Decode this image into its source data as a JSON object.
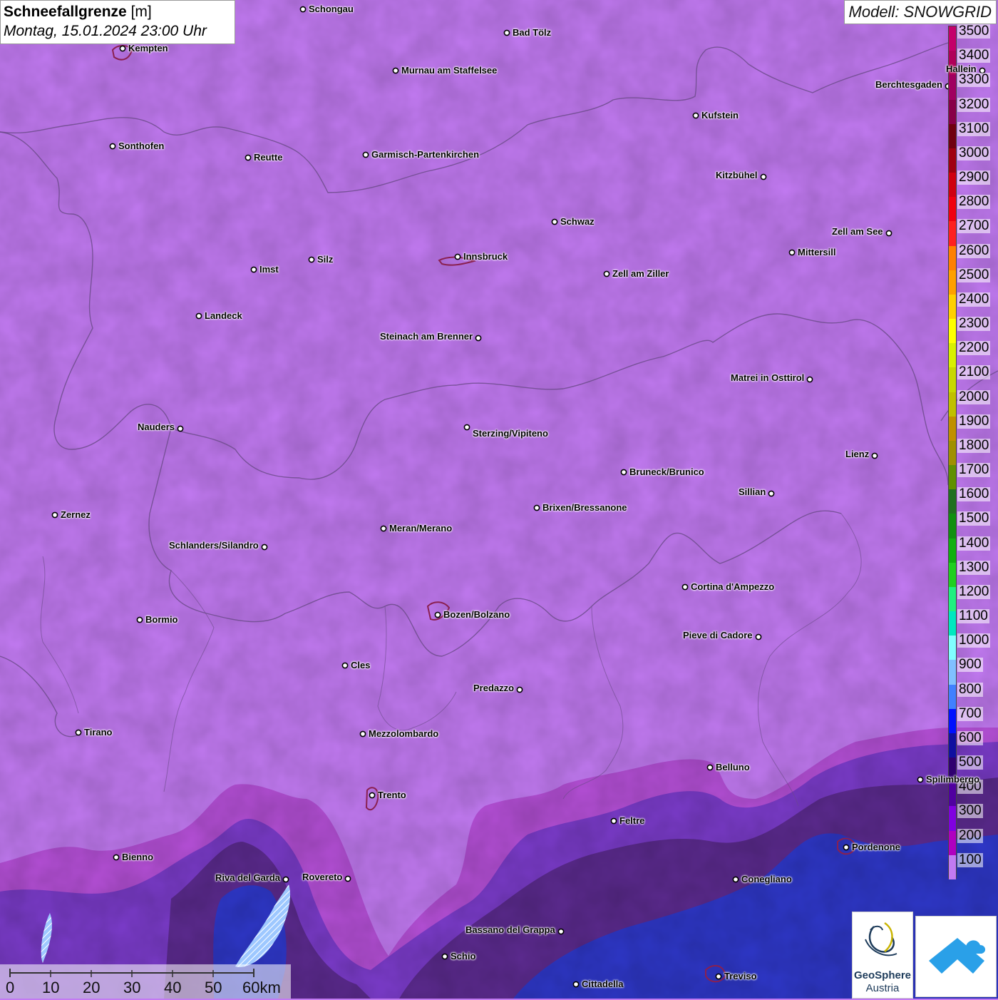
{
  "title": {
    "variable": "Schneefallgrenze",
    "unit": "[m]",
    "datetime": "Montag, 15.01.2024 23:00 Uhr"
  },
  "model": "Modell: SNOWGRID",
  "legend": [
    {
      "label": "3500",
      "color": "#c4006a"
    },
    {
      "label": "3400",
      "color": "#b0005a"
    },
    {
      "label": "3300",
      "color": "#a00060"
    },
    {
      "label": "3200",
      "color": "#880048"
    },
    {
      "label": "3100",
      "color": "#700010"
    },
    {
      "label": "3000",
      "color": "#a00010"
    },
    {
      "label": "2900",
      "color": "#d00010"
    },
    {
      "label": "2800",
      "color": "#f00010"
    },
    {
      "label": "2700",
      "color": "#ff2020"
    },
    {
      "label": "2600",
      "color": "#ff8000"
    },
    {
      "label": "2500",
      "color": "#ffa000"
    },
    {
      "label": "2400",
      "color": "#ffd000"
    },
    {
      "label": "2300",
      "color": "#ffff00"
    },
    {
      "label": "2200",
      "color": "#d8f000"
    },
    {
      "label": "2100",
      "color": "#c8d800"
    },
    {
      "label": "2000",
      "color": "#c0c000"
    },
    {
      "label": "1900",
      "color": "#c09000"
    },
    {
      "label": "1800",
      "color": "#a09000"
    },
    {
      "label": "1700",
      "color": "#609000"
    },
    {
      "label": "1600",
      "color": "#207020"
    },
    {
      "label": "1500",
      "color": "#109010"
    },
    {
      "label": "1400",
      "color": "#10b010"
    },
    {
      "label": "1300",
      "color": "#20d020"
    },
    {
      "label": "1200",
      "color": "#20f080"
    },
    {
      "label": "1100",
      "color": "#00e8c0"
    },
    {
      "label": "1000",
      "color": "#80ffff"
    },
    {
      "label": "900",
      "color": "#80c0ff"
    },
    {
      "label": "800",
      "color": "#4080ff"
    },
    {
      "label": "700",
      "color": "#0010ff"
    },
    {
      "label": "600",
      "color": "#1010a0"
    },
    {
      "label": "500",
      "color": "#300070"
    },
    {
      "label": "400",
      "color": "#5000a0"
    },
    {
      "label": "300",
      "color": "#8000e0"
    },
    {
      "label": "200",
      "color": "#b000c0"
    },
    {
      "label": "100",
      "color": "#c27af2"
    }
  ],
  "cities": [
    {
      "name": "Schongau",
      "anchor": "right"
    },
    {
      "name": "Bad Tölz",
      "anchor": "right"
    },
    {
      "name": "Kempten",
      "anchor": "right"
    },
    {
      "name": "Murnau am Staffelsee",
      "anchor": "right"
    },
    {
      "name": "Hallein",
      "anchor": "left"
    },
    {
      "name": "Berchtesgaden",
      "anchor": "left"
    },
    {
      "name": "Kufstein",
      "anchor": "right"
    },
    {
      "name": "Sonthofen",
      "anchor": "right"
    },
    {
      "name": "Reutte",
      "anchor": "right"
    },
    {
      "name": "Garmisch-Partenkirchen",
      "anchor": "right"
    },
    {
      "name": "Kitzbühel",
      "anchor": "left"
    },
    {
      "name": "Schwaz",
      "anchor": "right"
    },
    {
      "name": "Zell am See",
      "anchor": "left"
    },
    {
      "name": "Mittersill",
      "anchor": "right"
    },
    {
      "name": "Innsbruck",
      "anchor": "right"
    },
    {
      "name": "Silz",
      "anchor": "right"
    },
    {
      "name": "Imst",
      "anchor": "right"
    },
    {
      "name": "Zell am Ziller",
      "anchor": "right"
    },
    {
      "name": "Landeck",
      "anchor": "right"
    },
    {
      "name": "Steinach am Brenner",
      "anchor": "left"
    },
    {
      "name": "Matrei in Osttirol",
      "anchor": "left"
    },
    {
      "name": "Nauders",
      "anchor": "left"
    },
    {
      "name": "Sterzing/Vipiteno",
      "anchor": "below"
    },
    {
      "name": "Lienz",
      "anchor": "left"
    },
    {
      "name": "Bruneck/Brunico",
      "anchor": "right"
    },
    {
      "name": "Sillian",
      "anchor": "left"
    },
    {
      "name": "Brixen/Bressanone",
      "anchor": "right"
    },
    {
      "name": "Zernez",
      "anchor": "right"
    },
    {
      "name": "Meran/Merano",
      "anchor": "right"
    },
    {
      "name": "Schlanders/Silandro",
      "anchor": "left"
    },
    {
      "name": "Cortina d'Ampezzo",
      "anchor": "right"
    },
    {
      "name": "Bozen/Bolzano",
      "anchor": "right"
    },
    {
      "name": "Bormio",
      "anchor": "right"
    },
    {
      "name": "Pieve di Cadore",
      "anchor": "left"
    },
    {
      "name": "Cles",
      "anchor": "right"
    },
    {
      "name": "Predazzo",
      "anchor": "left"
    },
    {
      "name": "Tirano",
      "anchor": "right"
    },
    {
      "name": "Mezzolombardo",
      "anchor": "right"
    },
    {
      "name": "Belluno",
      "anchor": "right"
    },
    {
      "name": "Spilimbergo",
      "anchor": "right"
    },
    {
      "name": "Trento",
      "anchor": "right"
    },
    {
      "name": "Feltre",
      "anchor": "right"
    },
    {
      "name": "Bienno",
      "anchor": "right"
    },
    {
      "name": "Pordenone",
      "anchor": "right"
    },
    {
      "name": "Riva del Garda",
      "anchor": "left"
    },
    {
      "name": "Rovereto",
      "anchor": "left"
    },
    {
      "name": "Conegliano",
      "anchor": "right"
    },
    {
      "name": "Bassano del Grappa",
      "anchor": "left"
    },
    {
      "name": "Schio",
      "anchor": "right"
    },
    {
      "name": "Treviso",
      "anchor": "right"
    },
    {
      "name": "Cittadella",
      "anchor": "right"
    }
  ],
  "scale_bar": {
    "labels": [
      "0",
      "10",
      "20",
      "30",
      "40",
      "50",
      "60km"
    ]
  },
  "logos": {
    "geosphere_line1": "GeoSphere",
    "geosphere_line2": "Austria"
  },
  "colors": {
    "base_100": "#c27af2",
    "band_200": "#b44fd6",
    "band_300": "#7a3bc9",
    "band_400": "#5b2a8e",
    "band_700": "#2e37c8",
    "borders": "#6a4a88",
    "city_boundary": "#8a2050"
  }
}
